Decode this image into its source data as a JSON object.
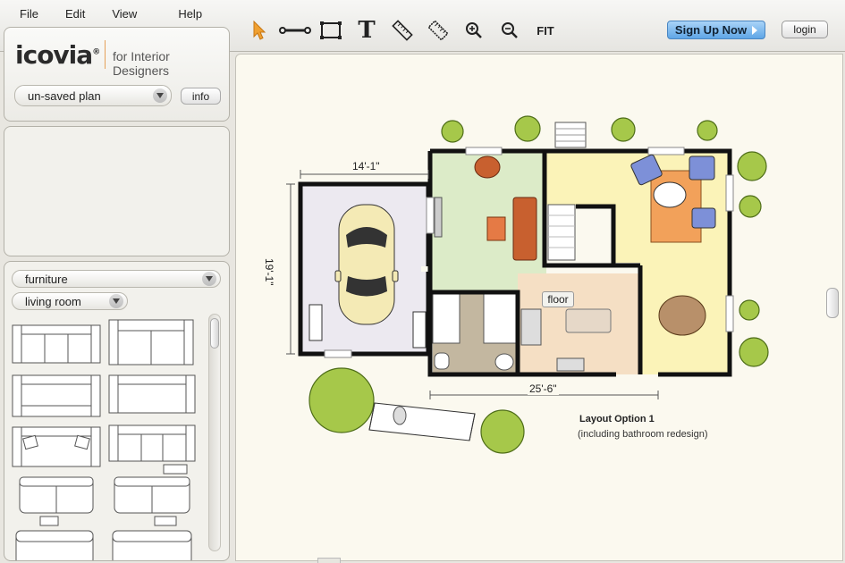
{
  "menu": [
    "File",
    "Edit",
    "View",
    "Help"
  ],
  "toolbar": {
    "tools": [
      "select-arrow-icon",
      "wall-tool-icon",
      "room-tool-icon",
      "text-tool-icon",
      "ruler-icon",
      "dimension-icon",
      "zoom-in-icon",
      "zoom-out-icon"
    ],
    "text_glyph": "T",
    "fit_label": "FIT"
  },
  "header": {
    "signup_label": "Sign Up Now",
    "login_label": "login"
  },
  "brand": {
    "logo": "icovia",
    "trademark": "®",
    "tagline": "for Interior Designers",
    "accent": "#e5a15a"
  },
  "plan": {
    "current": "un-saved plan",
    "info_label": "info"
  },
  "library": {
    "category": "furniture",
    "room": "living room"
  },
  "floorplan": {
    "garage_width": "14'-1\"",
    "garage_depth": "19'-1\"",
    "house_width": "25'-6\"",
    "floor_label": "floor",
    "caption_title": "Layout Option 1",
    "caption_subtitle": "(including bathroom redesign)"
  },
  "colors": {
    "signup": "#5fa6e6",
    "living_room": "#dcebc8",
    "dining_area": "#fbf3b8",
    "garage": "#ece9f0",
    "kitchen": "#f5dfc4",
    "tree": "#a6c84a"
  }
}
